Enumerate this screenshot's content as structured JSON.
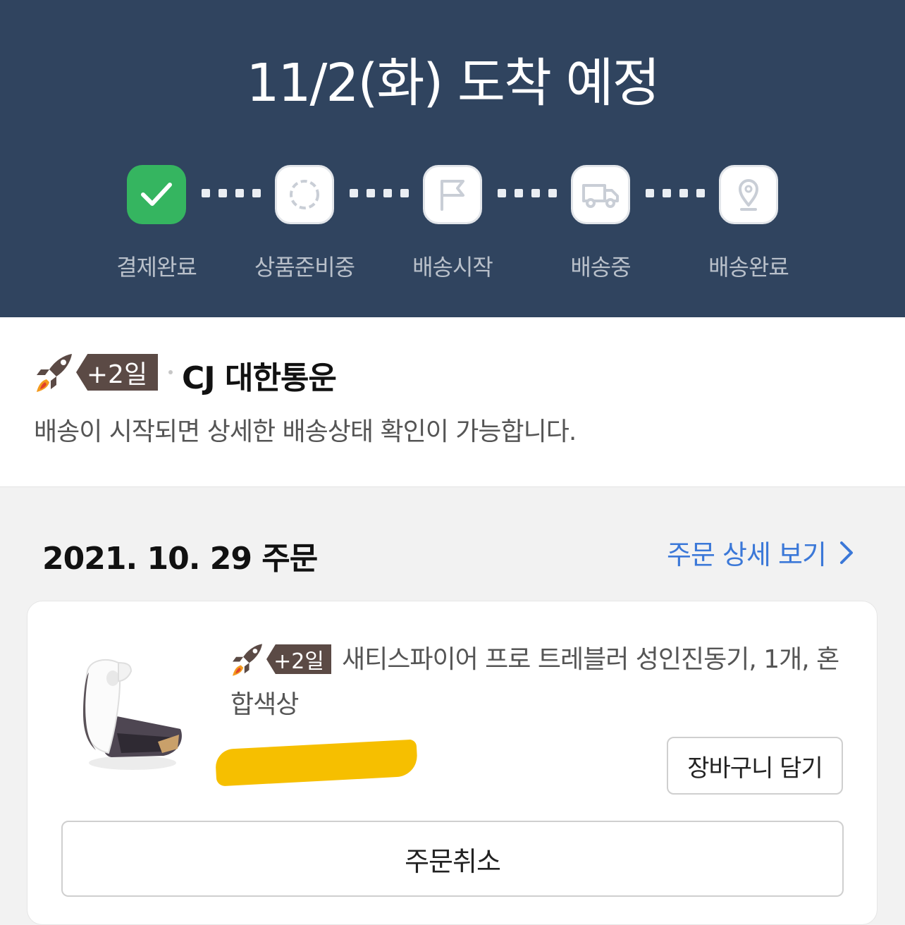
{
  "header": {
    "arrival_title": "11/2(화) 도착 예정",
    "steps": [
      {
        "label": "결제완료",
        "icon": "check-icon",
        "state": "done"
      },
      {
        "label": "상품준비중",
        "icon": "loading-circle-icon",
        "state": "pending"
      },
      {
        "label": "배송시작",
        "icon": "flag-icon",
        "state": "pending"
      },
      {
        "label": "배송중",
        "icon": "truck-icon",
        "state": "pending"
      },
      {
        "label": "배송완료",
        "icon": "location-pin-icon",
        "state": "pending"
      }
    ],
    "colors": {
      "background": "#30445f",
      "done": "#35b560",
      "label": "#b9c0ca"
    }
  },
  "shipping": {
    "badge": "+2일",
    "carrier": "CJ 대한통운",
    "message": "배송이 시작되면 상세한 배송상태 확인이 가능합니다."
  },
  "order": {
    "date_label": "2021. 10. 29 주문",
    "detail_link": "주문 상세 보기",
    "product": {
      "badge": "+2일",
      "title": "새티스파이어 프로 트레블러 성인진동기, 1개, 혼합색상"
    },
    "add_to_cart": "장바구니 담기",
    "cancel": "주문취소"
  },
  "colors": {
    "link": "#3b78d8",
    "badge": "#5b4a45",
    "redaction": "#f6bf00"
  }
}
